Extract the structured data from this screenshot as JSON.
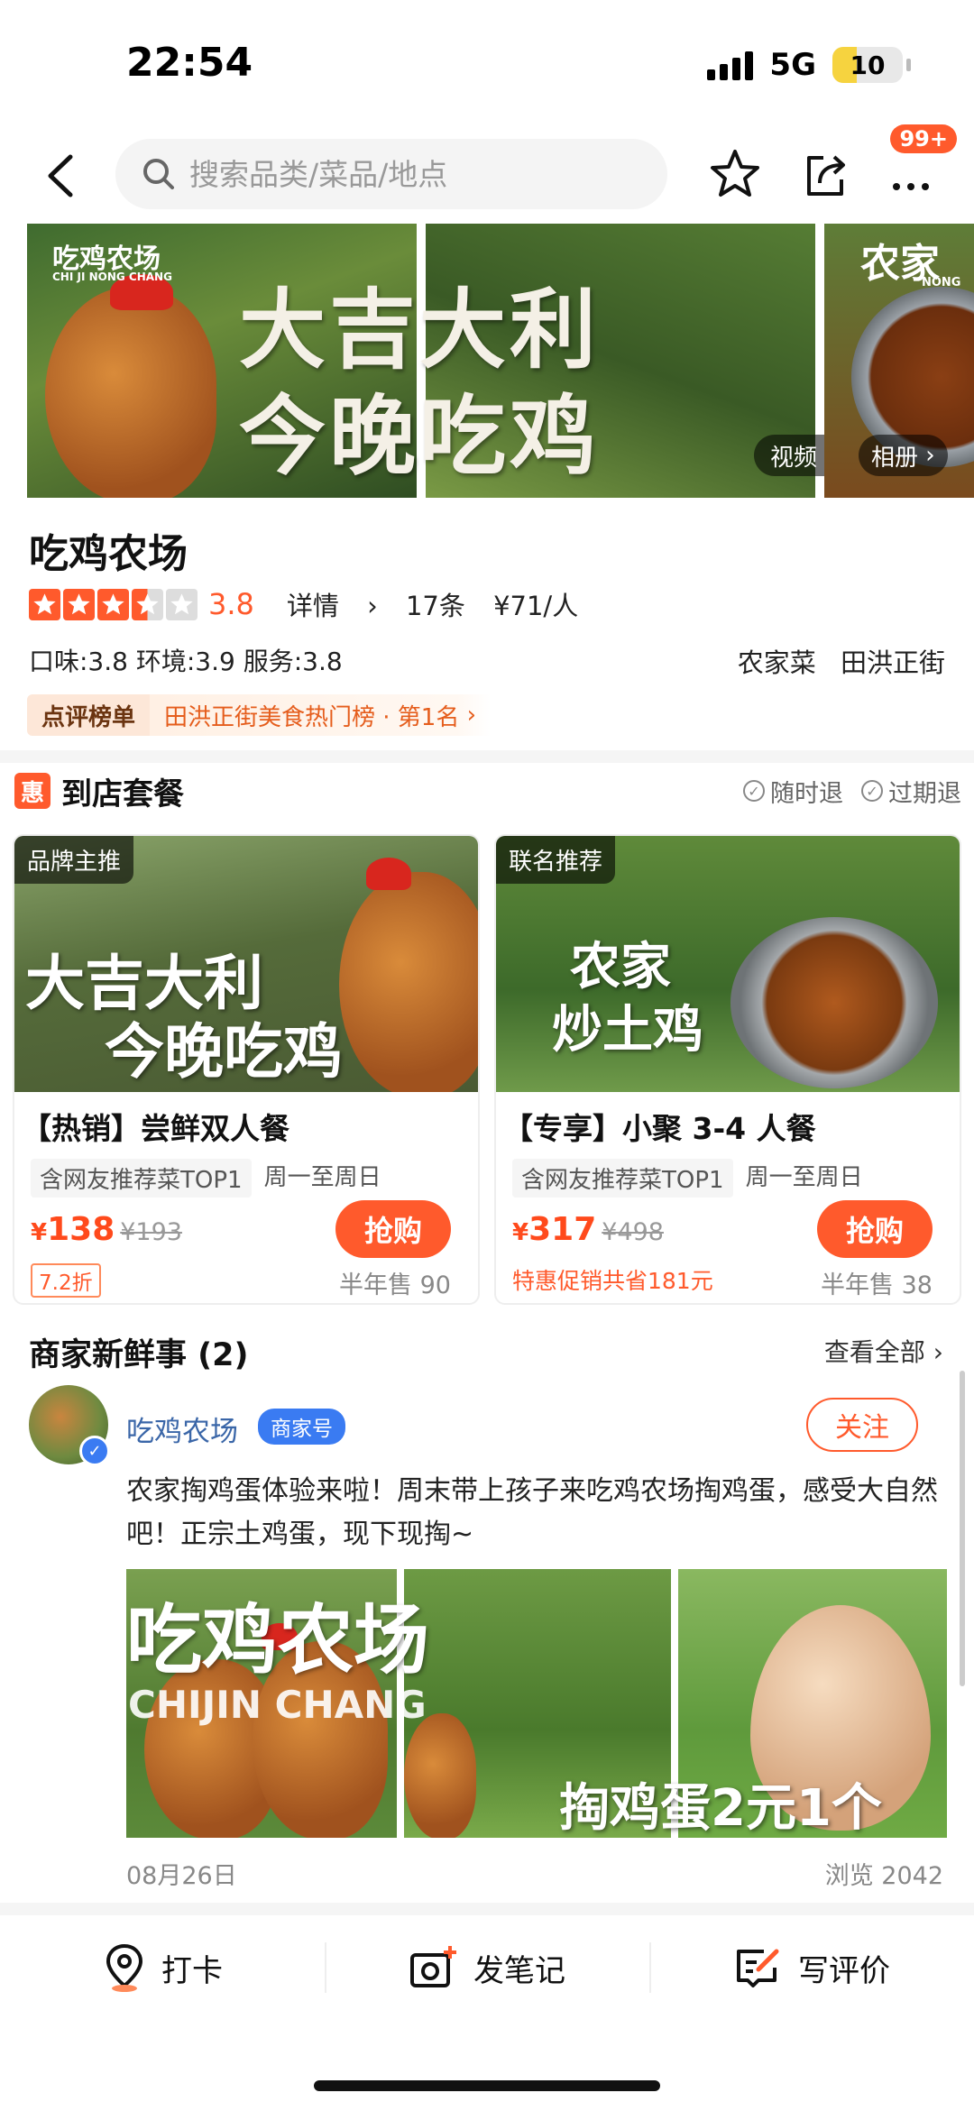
{
  "status_bar": {
    "time": "22:54",
    "network": "5G",
    "battery": "10"
  },
  "header": {
    "search_placeholder": "搜索品类/菜品/地点",
    "notification_badge": "99+"
  },
  "gallery": {
    "logo": "吃鸡农场",
    "logo_sub": "CHI JI NONG CHANG",
    "headline_line1": "大吉大利",
    "headline_line2": "今晚吃鸡",
    "third_title": "农家",
    "third_sub": "NONG",
    "video_label": "视频",
    "album_label": "相册"
  },
  "shop": {
    "name": "吃鸡农场",
    "rating": 3.5,
    "score": "3.8",
    "details_label": "详情",
    "review_count": "17条",
    "avg_price": "¥71/人",
    "sub_scores": "口味:3.8  环境:3.9  服务:3.8",
    "tags": [
      "农家菜",
      "田洪正街"
    ],
    "rank_label": "点评榜单",
    "rank_text": "田洪正街美食热门榜 · 第1名"
  },
  "deals": {
    "title": "到店套餐",
    "hui_icon_text": "惠",
    "flags": [
      "随时退",
      "过期退"
    ],
    "items": [
      {
        "tag": "品牌主推",
        "img_line1": "大吉大利",
        "img_line2": "今晚吃鸡",
        "name": "【热销】尝鲜双人餐",
        "chip": "含网友推荐菜TOP1",
        "days": "周一至周日",
        "yen": "¥",
        "price": "138",
        "old_price": "¥193",
        "buy_label": "抢购",
        "discount": "7.2折",
        "sales": "半年售 90"
      },
      {
        "tag": "联名推荐",
        "img_line1": "农家",
        "img_line2": "炒土鸡",
        "name": "【专享】小聚 3-4 人餐",
        "chip": "含网友推荐菜TOP1",
        "days": "周一至周日",
        "yen": "¥",
        "price": "317",
        "old_price": "¥498",
        "buy_label": "抢购",
        "promo": "特惠促销共省181元",
        "sales": "半年售 38"
      }
    ]
  },
  "news": {
    "title": "商家新鲜事 (2)",
    "view_all": "查看全部",
    "author": "吃鸡农场",
    "merchant_tag": "商家号",
    "follow_label": "关注",
    "text": "农家掏鸡蛋体验来啦！周末带上孩子来吃鸡农场掏鸡蛋，感受大自然吧！正宗土鸡蛋，现下现掏~",
    "img_title": "吃鸡农场",
    "img_sub": "CHIJIN CHANG",
    "img_eggs": "掏鸡蛋2元1个",
    "date": "08月26日",
    "views": "浏览 2042"
  },
  "bottom_bar": {
    "checkin": "打卡",
    "note": "发笔记",
    "review": "写评价"
  },
  "colors": {
    "accent": "#ff5a2c",
    "link_blue": "#3a66a8",
    "merchant_blue": "#3a7bf2"
  }
}
